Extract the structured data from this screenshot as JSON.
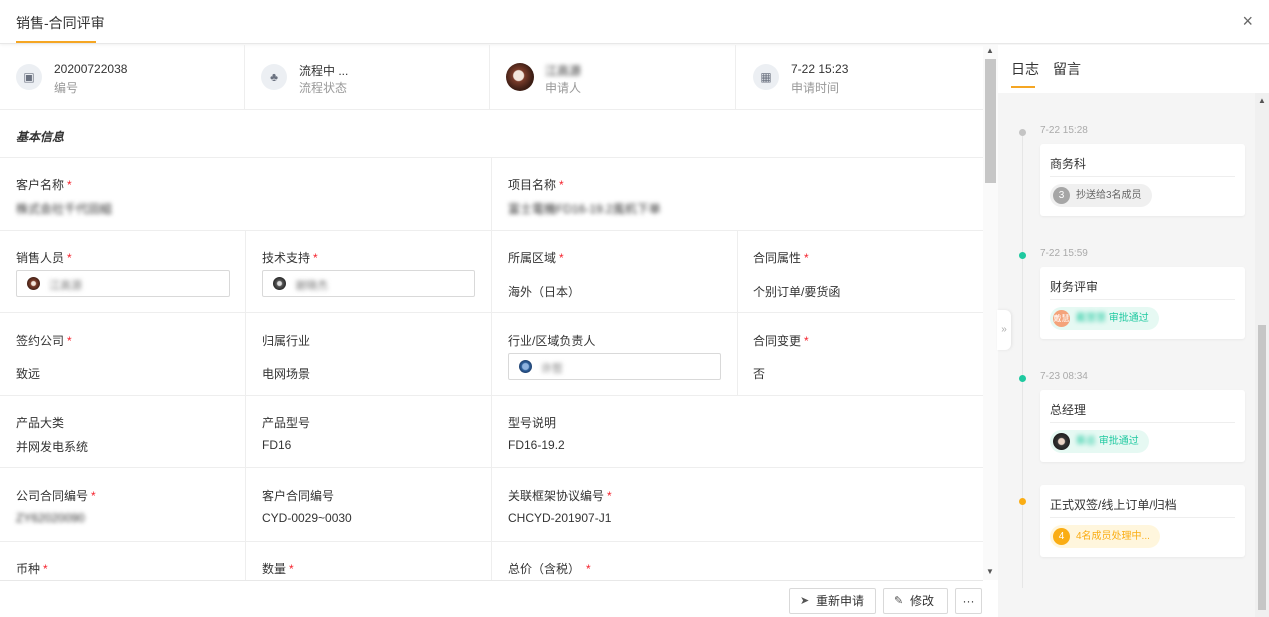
{
  "window": {
    "title": "销售-合同评审",
    "close_glyph": "×"
  },
  "summary": [
    {
      "value": "20200722038",
      "label": "编号",
      "icon": "document-icon",
      "glyph": "▣"
    },
    {
      "value": "流程中 ...",
      "label": "流程状态",
      "icon": "flow-icon",
      "glyph": "♣"
    },
    {
      "value": "江高源",
      "label": "申请人",
      "icon": "avatar"
    },
    {
      "value": "7-22 15:23",
      "label": "申请时间",
      "icon": "calendar-icon",
      "glyph": "▦"
    }
  ],
  "section": {
    "basic_info": "基本信息"
  },
  "form": {
    "customer_name": {
      "label": "客户名称",
      "value": "株式会社千代田組"
    },
    "project_name": {
      "label": "项目名称",
      "value": "富士電機FD16-19.2風机下单"
    },
    "sales_person": {
      "label": "销售人员",
      "value": "江高源"
    },
    "tech_support": {
      "label": "技术支持",
      "value": "谢晓杰"
    },
    "region": {
      "label": "所属区域",
      "value": "海外（日本）"
    },
    "contract_attr": {
      "label": "合同属性",
      "value": "个别订单/要货函"
    },
    "sign_company": {
      "label": "签约公司",
      "value": "致远"
    },
    "industry": {
      "label": "归属行业",
      "value": "电网场景"
    },
    "industry_manager": {
      "label": "行业/区域负责人",
      "value": "许哲"
    },
    "contract_change": {
      "label": "合同变更",
      "value": "否"
    },
    "product_category": {
      "label": "产品大类",
      "value": "并网发电系统"
    },
    "product_model": {
      "label": "产品型号",
      "value": "FD16"
    },
    "model_desc": {
      "label": "型号说明",
      "value": "FD16-19.2"
    },
    "company_contract_no": {
      "label": "公司合同编号",
      "value": "ZY62020090"
    },
    "customer_contract_no": {
      "label": "客户合同编号",
      "value": "CYD-0029~0030"
    },
    "framework_no": {
      "label": "关联框架协议编号",
      "value": "CHCYD-201907-J1"
    },
    "currency": {
      "label": "币种"
    },
    "quantity": {
      "label": "数量"
    },
    "total_price": {
      "label": "总价（含税）"
    }
  },
  "footer": {
    "reapply": "重新申请",
    "edit": "修改",
    "more": "···"
  },
  "right_panel": {
    "tabs": [
      "日志",
      "留言"
    ],
    "timeline": [
      {
        "time": "7-22 15:28",
        "title": "商务科",
        "pill_count": "3",
        "pill_text": "抄送给3名成员",
        "status": "cc"
      },
      {
        "time": "7-22 15:59",
        "title": "财务评审",
        "pill_avatar": "戴慧",
        "pill_name": "戴慧慧",
        "pill_text": "审批通过",
        "status": "approved"
      },
      {
        "time": "7-23 08:34",
        "title": "总经理",
        "pill_name": "蔡总",
        "pill_text": "审批通过",
        "status": "approved"
      },
      {
        "time": "",
        "title": "正式双签/线上订单/归档",
        "pill_count": "4",
        "pill_text": "4名成员处理中...",
        "status": "pending"
      }
    ]
  },
  "colors": {
    "accent": "#f5a623",
    "required": "#f5222d",
    "approved": "#1fc9a0",
    "approved_bg": "#e6f9f3",
    "pending": "#faad14",
    "pending_bg": "#fff6dd",
    "cc": "#a6a6a6",
    "cc_bg": "#f0f0f0"
  }
}
